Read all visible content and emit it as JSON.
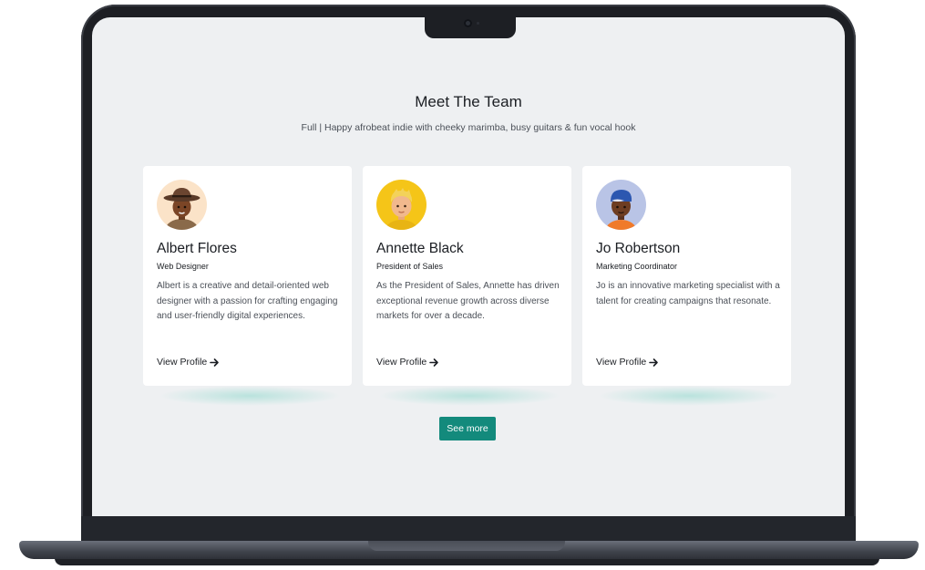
{
  "section": {
    "title": "Meet The Team",
    "subtitle": "Full | Happy afrobeat indie with cheeky marimba, busy guitars & fun vocal hook"
  },
  "team": [
    {
      "name": "Albert Flores",
      "role": "Web Designer",
      "bio": "Albert is a creative and detail-oriented web designer with a passion for crafting engaging and user-friendly digital experiences.",
      "link_label": "View Profile",
      "link_icon": "arrow-right-icon",
      "avatar_bg": "#fbe3c8"
    },
    {
      "name": "Annette Black",
      "role": "President of Sales",
      "bio": "As the President of Sales, Annette has driven exceptional revenue growth across diverse markets for over a decade.",
      "link_label": "View Profile",
      "link_icon": "arrow-right-icon",
      "avatar_bg": "#f5c518"
    },
    {
      "name": "Jo Robertson",
      "role": "Marketing Coordinator",
      "bio": "Jo is an innovative marketing specialist with a talent for creating campaigns that resonate.",
      "link_label": "View Profile",
      "link_icon": "arrow-right-icon",
      "avatar_bg": "#b9c4e6"
    }
  ],
  "cta": {
    "label": "See more"
  },
  "colors": {
    "accent": "#138a7c",
    "screen_bg": "#eef0f2"
  }
}
